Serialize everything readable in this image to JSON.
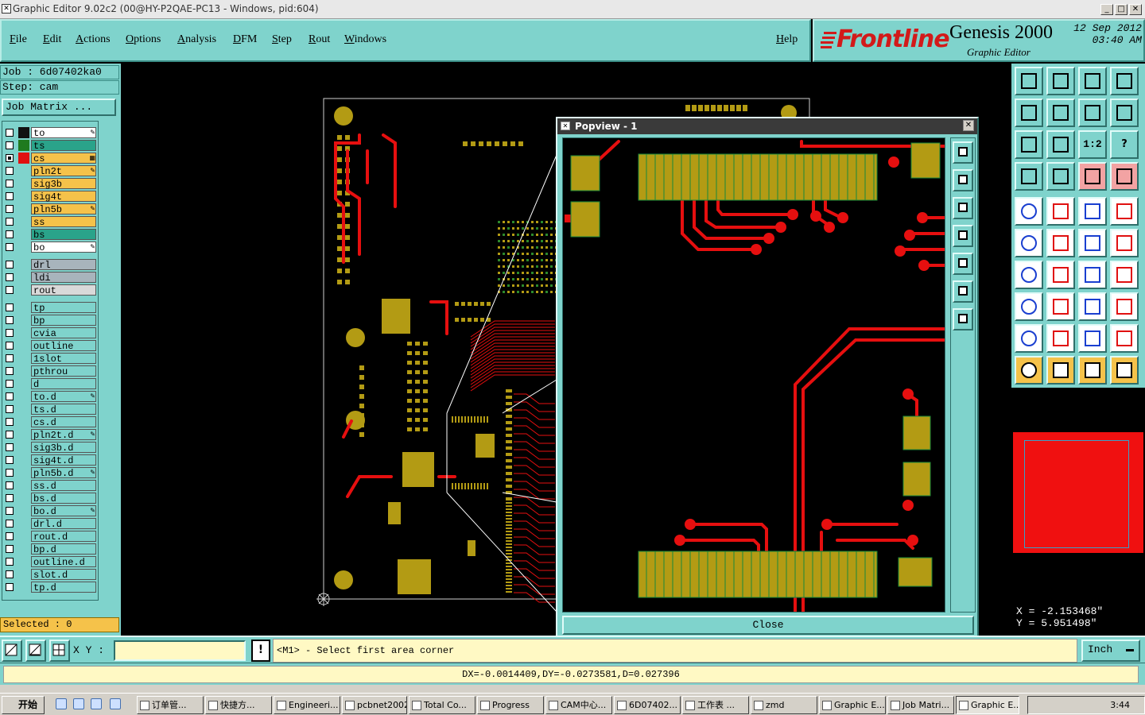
{
  "window": {
    "title": "Graphic Editor 9.02c2 (00@HY-P2QAE-PC13 - Windows, pid:604)"
  },
  "menu": {
    "items": [
      "File",
      "Edit",
      "Actions",
      "Options",
      "Analysis",
      "DFM",
      "Step",
      "Rout",
      "Windows"
    ],
    "help": "Help"
  },
  "brand": {
    "logo": "Frontline",
    "product": "Genesis 2000",
    "subtitle": "Graphic Editor",
    "date": "12 Sep 2012",
    "time": "03:40 AM"
  },
  "job": {
    "job_line": "Job : 6d07402ka0",
    "step_line": "Step: cam",
    "matrix_button": "Job Matrix ..."
  },
  "layers": [
    {
      "name": "to",
      "color": "#ffffff",
      "swatch": "#111111",
      "mark": "pen"
    },
    {
      "name": "ts",
      "color": "#2aa38a",
      "swatch": "#1f7a1f",
      "mark": ""
    },
    {
      "name": "cs",
      "color": "#f5c24a",
      "swatch": "#e01010",
      "mark": "grid",
      "checked": true
    },
    {
      "name": "pln2t",
      "color": "#f5c24a",
      "swatch": "",
      "mark": "pen"
    },
    {
      "name": "sig3b",
      "color": "#f5c24a",
      "swatch": "",
      "mark": ""
    },
    {
      "name": "sig4t",
      "color": "#f5c24a",
      "swatch": "",
      "mark": ""
    },
    {
      "name": "pln5b",
      "color": "#f5c24a",
      "swatch": "",
      "mark": "pen"
    },
    {
      "name": "ss",
      "color": "#f5c24a",
      "swatch": "",
      "mark": ""
    },
    {
      "name": "bs",
      "color": "#2aa38a",
      "swatch": "",
      "mark": ""
    },
    {
      "name": "bo",
      "color": "#ffffff",
      "swatch": "",
      "mark": "pen"
    },
    {
      "name": "drl",
      "color": "#a8b4bc",
      "swatch": "",
      "mark": ""
    },
    {
      "name": "ldi",
      "color": "#a8b4bc",
      "swatch": "",
      "mark": ""
    },
    {
      "name": "rout",
      "color": "#d9d9d9",
      "swatch": "",
      "mark": ""
    },
    {
      "name": "tp",
      "color": "#7fd3cc",
      "swatch": "",
      "mark": ""
    },
    {
      "name": "bp",
      "color": "#7fd3cc",
      "swatch": "",
      "mark": ""
    },
    {
      "name": "cvia",
      "color": "#7fd3cc",
      "swatch": "",
      "mark": ""
    },
    {
      "name": "outline",
      "color": "#7fd3cc",
      "swatch": "",
      "mark": ""
    },
    {
      "name": "1slot",
      "color": "#7fd3cc",
      "swatch": "",
      "mark": ""
    },
    {
      "name": "pthrou",
      "color": "#7fd3cc",
      "swatch": "",
      "mark": ""
    },
    {
      "name": "d",
      "color": "#7fd3cc",
      "swatch": "",
      "mark": ""
    },
    {
      "name": "to.d",
      "color": "#7fd3cc",
      "swatch": "",
      "mark": "pen"
    },
    {
      "name": "ts.d",
      "color": "#7fd3cc",
      "swatch": "",
      "mark": ""
    },
    {
      "name": "cs.d",
      "color": "#7fd3cc",
      "swatch": "",
      "mark": ""
    },
    {
      "name": "pln2t.d",
      "color": "#7fd3cc",
      "swatch": "",
      "mark": "pen"
    },
    {
      "name": "sig3b.d",
      "color": "#7fd3cc",
      "swatch": "",
      "mark": ""
    },
    {
      "name": "sig4t.d",
      "color": "#7fd3cc",
      "swatch": "",
      "mark": ""
    },
    {
      "name": "pln5b.d",
      "color": "#7fd3cc",
      "swatch": "",
      "mark": "pen"
    },
    {
      "name": "ss.d",
      "color": "#7fd3cc",
      "swatch": "",
      "mark": ""
    },
    {
      "name": "bs.d",
      "color": "#7fd3cc",
      "swatch": "",
      "mark": ""
    },
    {
      "name": "bo.d",
      "color": "#7fd3cc",
      "swatch": "",
      "mark": "pen"
    },
    {
      "name": "drl.d",
      "color": "#7fd3cc",
      "swatch": "",
      "mark": ""
    },
    {
      "name": "rout.d",
      "color": "#7fd3cc",
      "swatch": "",
      "mark": ""
    },
    {
      "name": "bp.d",
      "color": "#7fd3cc",
      "swatch": "",
      "mark": ""
    },
    {
      "name": "outline.d",
      "color": "#7fd3cc",
      "swatch": "",
      "mark": ""
    },
    {
      "name": "slot.d",
      "color": "#7fd3cc",
      "swatch": "",
      "mark": ""
    },
    {
      "name": "tp.d",
      "color": "#7fd3cc",
      "swatch": "",
      "mark": ""
    }
  ],
  "selected": "Selected : 0",
  "popview": {
    "title": "Popview - 1",
    "close": "Close"
  },
  "toolbox": {
    "ratio_label": "1:2",
    "help_label": "?"
  },
  "coords": {
    "x": "X = -2.153468\"",
    "y": "Y = 5.951498\""
  },
  "command": {
    "xy_label": "X Y :",
    "xy_value": "",
    "prompt": "<M1> - Select first area corner",
    "unit": "Inch"
  },
  "measure": "DX=-0.0014409,DY=-0.0273581,D=0.027396",
  "taskbar": {
    "start": "开始",
    "tasks": [
      "订单管...",
      "快捷方...",
      "Engineeri...",
      "pcbnet2002",
      "Total Co...",
      "Progress",
      "CAM中心...",
      "6D07402...",
      "工作表 ...",
      "zmd",
      "Graphic E...",
      "Job Matri...",
      "Graphic E..."
    ],
    "active_index": 12,
    "clock": "3:44"
  },
  "colors": {
    "panel": "#7fd3cc",
    "copper": "#b39b14",
    "trace": "#e60f0f",
    "accent": "#f5c24a"
  }
}
